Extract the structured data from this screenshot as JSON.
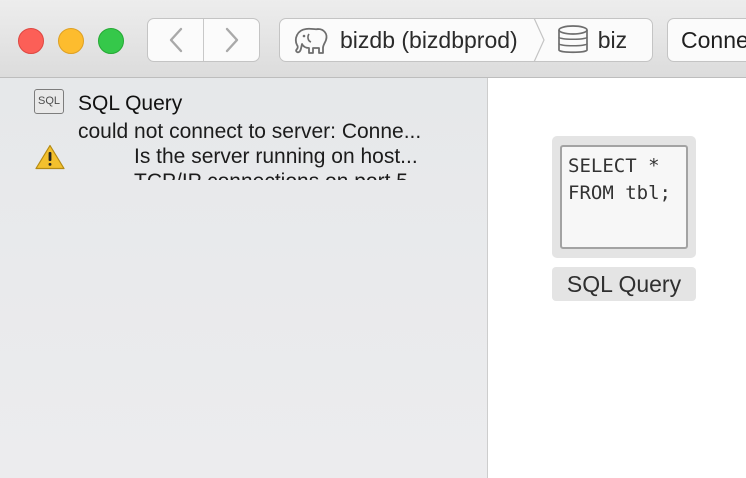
{
  "window": {
    "traffic_lights": {
      "close": "#fc5f57",
      "minimize": "#fdbc2e",
      "zoom": "#35c84a"
    }
  },
  "toolbar": {
    "back_icon": "chevron-left-icon",
    "forward_icon": "chevron-right-icon",
    "breadcrumb": {
      "database": {
        "icon": "postgres-elephant-icon",
        "label": "bizdb (bizdbprod)"
      },
      "schema": {
        "icon": "database-cylinder-icon",
        "label": "biz"
      }
    },
    "connect_label": "Conne"
  },
  "sidebar": {
    "query": {
      "badge": "SQL",
      "title": "SQL Query"
    },
    "error": {
      "icon": "warning-icon",
      "lines": [
        "could not connect to server: Conne...",
        "Is the server running on host...",
        "TCP/IP connections on port 5"
      ]
    }
  },
  "main": {
    "snippet": {
      "code": "SELECT *\nFROM tbl;",
      "caption": "SQL Query"
    }
  }
}
